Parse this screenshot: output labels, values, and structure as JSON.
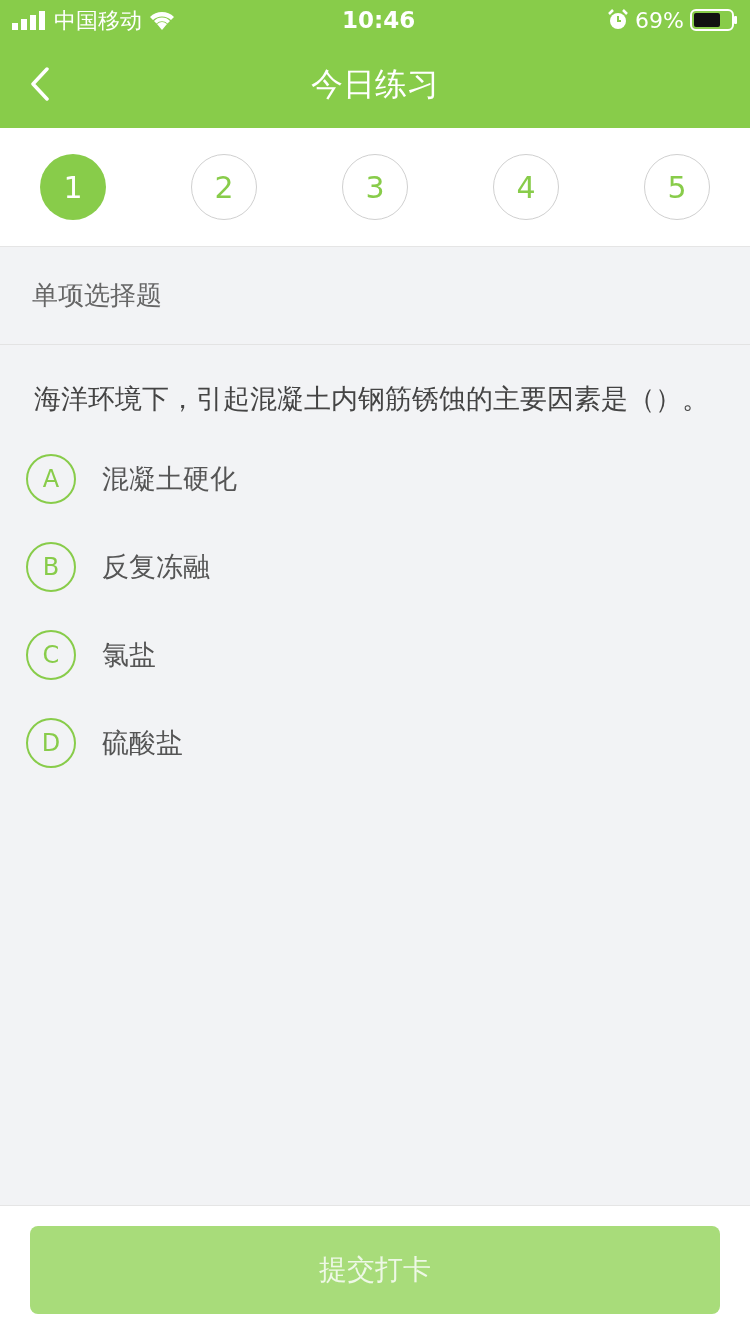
{
  "status_bar": {
    "carrier": "中国移动",
    "time": "10:46",
    "battery": "69%"
  },
  "nav": {
    "title": "今日练习"
  },
  "steps": [
    {
      "label": "1",
      "selected": true
    },
    {
      "label": "2",
      "selected": false
    },
    {
      "label": "3",
      "selected": false
    },
    {
      "label": "4",
      "selected": false
    },
    {
      "label": "5",
      "selected": false
    }
  ],
  "section": {
    "title": "单项选择题"
  },
  "question": {
    "text": "海洋环境下，引起混凝土内钢筋锈蚀的主要因素是（）。",
    "options": [
      {
        "letter": "A",
        "text": "混凝土硬化",
        "selected": false
      },
      {
        "letter": "B",
        "text": "反复冻融",
        "selected": false
      },
      {
        "letter": "C",
        "text": "氯盐",
        "selected": false
      },
      {
        "letter": "D",
        "text": "硫酸盐",
        "selected": false
      }
    ]
  },
  "submit": {
    "label": "提交打卡",
    "disabled": true
  }
}
